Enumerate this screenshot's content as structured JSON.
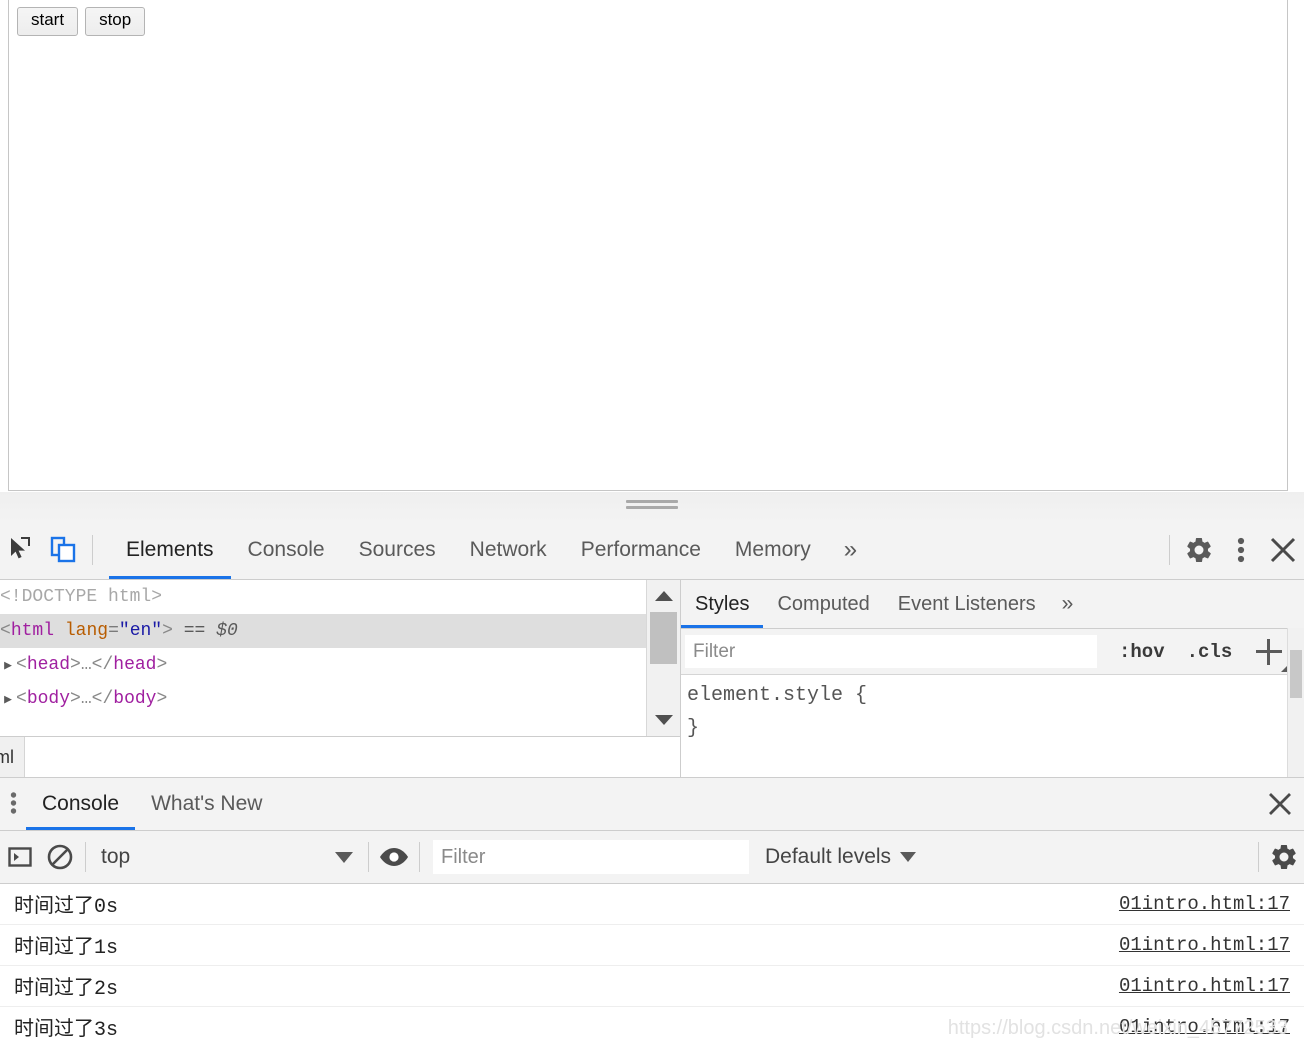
{
  "page": {
    "buttons": [
      {
        "label": "start",
        "name": "start-button"
      },
      {
        "label": "stop",
        "name": "stop-button"
      }
    ]
  },
  "devtools": {
    "toolbar": {
      "inspect_icon": "inspect-cursor-icon",
      "device_toolbar_icon": "device-toolbar-icon",
      "device_toolbar_color": "#1a73e8",
      "tabs": [
        {
          "label": "Elements",
          "active": true
        },
        {
          "label": "Console",
          "active": false
        },
        {
          "label": "Sources",
          "active": false
        },
        {
          "label": "Network",
          "active": false
        },
        {
          "label": "Performance",
          "active": false
        },
        {
          "label": "Memory",
          "active": false
        }
      ],
      "more_tabs_label": "»",
      "settings_icon": "gear-icon",
      "menu_icon": "kebab-menu-icon",
      "close_icon": "close-icon"
    },
    "elements": {
      "dom_rows": [
        {
          "type": "doctype",
          "text": "<!DOCTYPE html>",
          "twisty": false,
          "selected": false
        },
        {
          "type": "element",
          "tag": "html",
          "attr": "lang",
          "value": "en",
          "suffix": "== $0",
          "twisty": false,
          "selected": true
        },
        {
          "type": "collapsed",
          "tag": "head",
          "twisty": true,
          "selected": false
        },
        {
          "type": "collapsed",
          "tag": "body",
          "twisty": true,
          "selected": false
        }
      ],
      "breadcrumb": [
        "tml"
      ]
    },
    "styles": {
      "tabs": [
        {
          "label": "Styles",
          "active": true
        },
        {
          "label": "Computed",
          "active": false
        },
        {
          "label": "Event Listeners",
          "active": false
        }
      ],
      "more_tabs_label": "»",
      "filter_placeholder": "Filter",
      "filter_value": "",
      "hov_label": ":hov",
      "cls_label": ".cls",
      "new_rule_icon": "plus-icon",
      "rule_selector": "element.style {",
      "rule_close": "}"
    },
    "drawer": {
      "kebab_icon": "kebab-menu-icon",
      "tabs": [
        {
          "label": "Console",
          "active": true
        },
        {
          "label": "What's New",
          "active": false
        }
      ],
      "close_icon": "close-icon",
      "console_toolbar": {
        "sidebar_icon": "console-sidebar-icon",
        "clear_icon": "clear-console-icon",
        "context": "top",
        "eye_icon": "live-expression-eye-icon",
        "filter_placeholder": "Filter",
        "filter_value": "",
        "levels": "Default levels",
        "settings_icon": "gear-icon"
      },
      "messages": [
        {
          "text": "时间过了0s",
          "source": "01intro.html:17"
        },
        {
          "text": "时间过了1s",
          "source": "01intro.html:17"
        },
        {
          "text": "时间过了2s",
          "source": "01intro.html:17"
        },
        {
          "text": "时间过了3s",
          "source": "01intro.html:17"
        }
      ]
    }
  },
  "watermark": "https://blog.csdn.net/weixin_45772533"
}
